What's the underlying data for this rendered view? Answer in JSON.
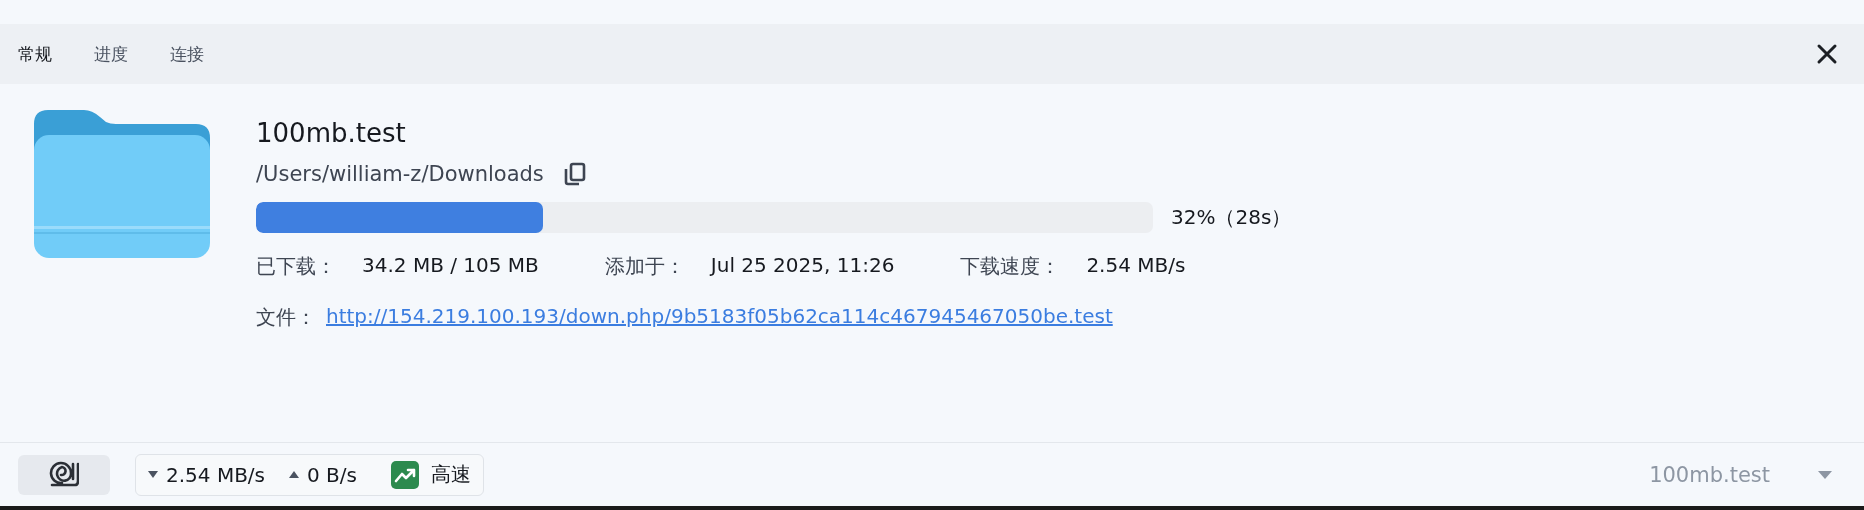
{
  "tabs": [
    {
      "label": "常规",
      "selected": true
    },
    {
      "label": "进度",
      "selected": false
    },
    {
      "label": "连接",
      "selected": false
    }
  ],
  "file": {
    "name": "100mb.test",
    "path": "/Users/william-z/Downloads",
    "progress": {
      "level": 0.32,
      "reading": "32%（28s）"
    },
    "stats": [
      {
        "label": "已下载：",
        "value": "34.2 MB / 105 MB"
      },
      {
        "label": "添加于：",
        "value": "Jul 25 2025, 11:26"
      },
      {
        "label": "下载速度：",
        "value": "2.54 MB/s"
      }
    ],
    "source": {
      "label": "文件：",
      "url": "http://154.219.100.193/down.php/9b5183f05b62ca114c467945467050be.test"
    }
  },
  "status_bar": {
    "download_speed": "2.54 MB/s",
    "upload_speed": "0 B/s",
    "speed_mode": "高速",
    "selected_task": "100mb.test"
  }
}
